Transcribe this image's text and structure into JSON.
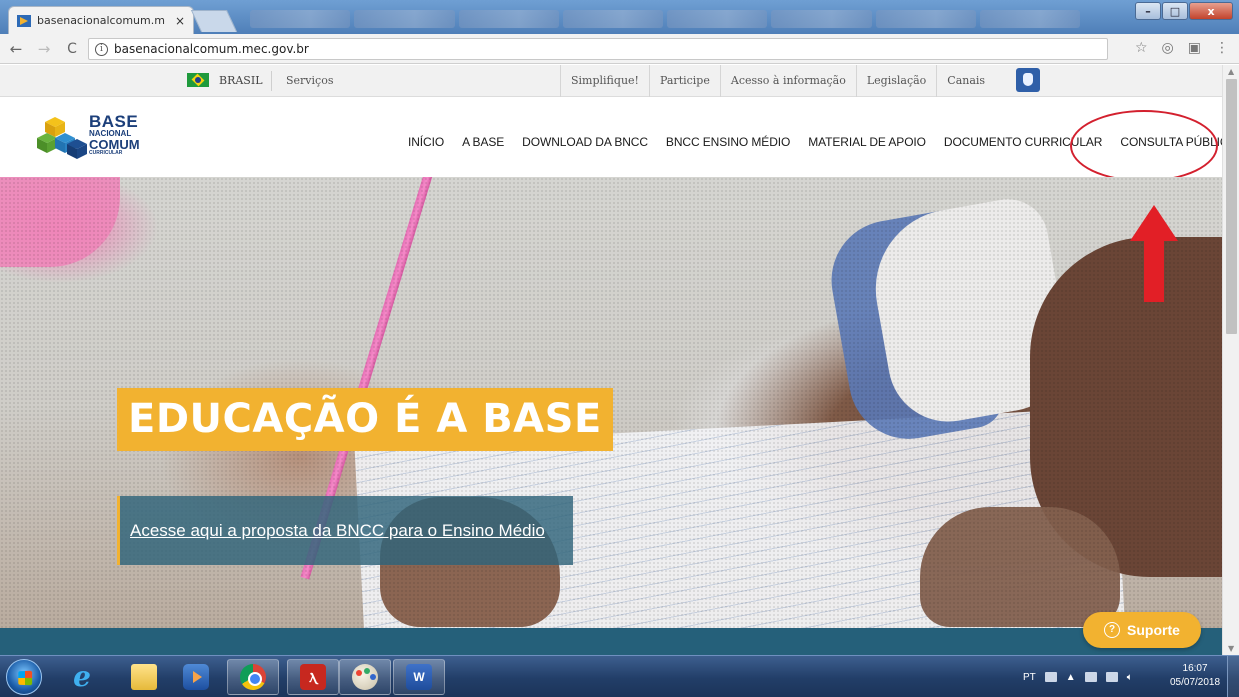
{
  "browser": {
    "tab_title": "basenacionalcomum.me",
    "tab_close": "×",
    "url": "basenacionalcomum.mec.gov.br",
    "nav": {
      "back": "←",
      "forward": "→",
      "reload": "C"
    },
    "window_buttons": {
      "minimize": "–",
      "maximize": "□",
      "close": "x"
    },
    "icons": [
      "star-icon",
      "extension-icon",
      "pdf-extension-icon",
      "menu-kebab-icon"
    ]
  },
  "gov_bar": {
    "brasil": "BRASIL",
    "servicos": "Serviços",
    "links": [
      "Simplifique!",
      "Participe",
      "Acesso à informação",
      "Legislação",
      "Canais"
    ]
  },
  "site": {
    "logo": {
      "line1": "BASE",
      "line2": "NACIONAL",
      "line3": "COMUM",
      "line4": "CURRICULAR"
    },
    "nav": [
      "INÍCIO",
      "A BASE",
      "DOWNLOAD DA BNCC",
      "BNCC ENSINO MÉDIO",
      "MATERIAL DE APOIO",
      "DOCUMENTO CURRICULAR",
      "CONSULTA PÚBLICA"
    ],
    "highlighted_nav": "CONSULTA PÚBLICA",
    "hero": {
      "headline": "EDUCAÇÃO É A BASE",
      "cta": "Acesse aqui a proposta da BNCC para o Ensino Médio"
    },
    "support_button": {
      "icon": "?",
      "label": "Suporte"
    }
  },
  "taskbar": {
    "apps": [
      "internet-explorer",
      "file-explorer",
      "media-player",
      "chrome",
      "acrobat-reader",
      "paint",
      "word"
    ],
    "active_app": "chrome",
    "language": "PT",
    "time": "16:07",
    "date": "05/07/2018"
  },
  "colors": {
    "accent_yellow": "#f2b230",
    "teal": "#25607a",
    "annotation_red": "#d3202e",
    "nav_text": "#1a1a1a"
  }
}
